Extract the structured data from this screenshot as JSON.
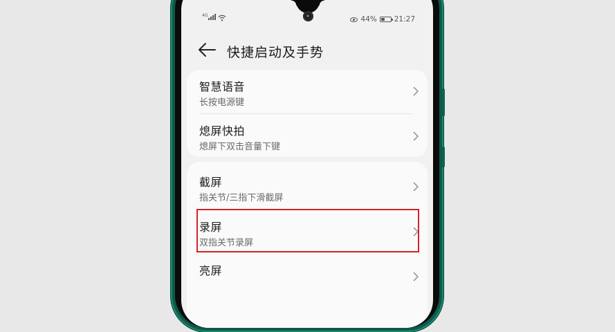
{
  "status_bar": {
    "network_type": "4G",
    "battery_percent": "44%",
    "time": "21:27",
    "icons": [
      "signal-icon",
      "wifi-icon",
      "eye-comfort-icon",
      "battery-icon"
    ]
  },
  "header": {
    "back_icon": "back-arrow-icon",
    "title": "快捷启动及手势"
  },
  "items": [
    {
      "title": "智慧语音",
      "subtitle": "长按电源键"
    },
    {
      "title": "熄屏快拍",
      "subtitle": "熄屏下双击音量下键"
    },
    {
      "title": "截屏",
      "subtitle": "指关节/三指下滑截屏"
    },
    {
      "title": "录屏",
      "subtitle": "双指关节录屏"
    },
    {
      "title": "亮屏",
      "subtitle": ""
    }
  ],
  "highlighted_item": "录屏",
  "colors": {
    "phone_frame": "#0c5a49",
    "highlight_border": "#d62027",
    "screen_bg": "#f1f1f1"
  }
}
